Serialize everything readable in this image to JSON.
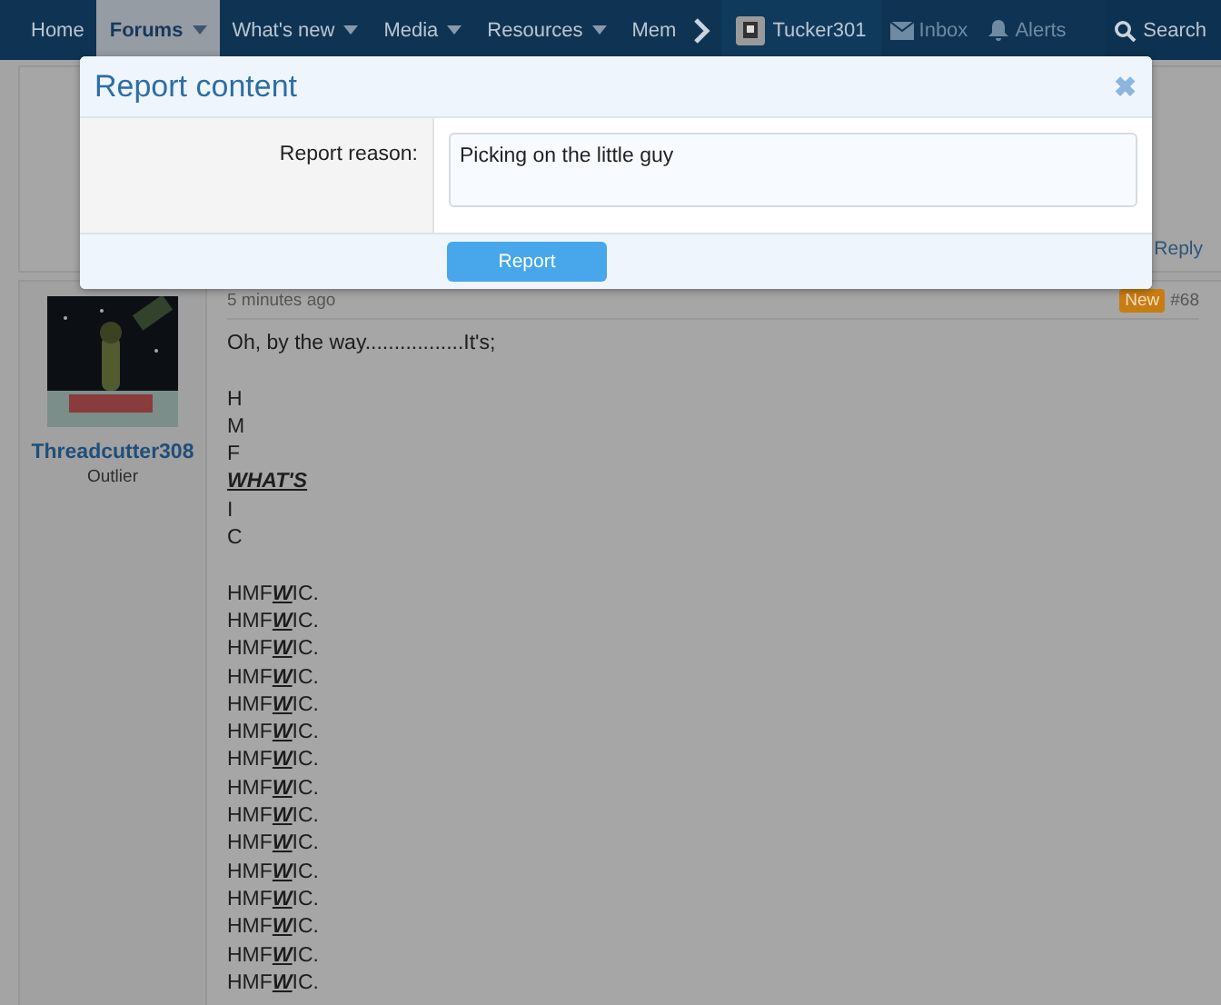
{
  "nav": {
    "items": [
      {
        "label": "Home",
        "selected": false,
        "dropdown": false
      },
      {
        "label": "Forums",
        "selected": true,
        "dropdown": true
      },
      {
        "label": "What's new",
        "selected": false,
        "dropdown": true
      },
      {
        "label": "Media",
        "selected": false,
        "dropdown": true
      },
      {
        "label": "Resources",
        "selected": false,
        "dropdown": true
      },
      {
        "label": "Mem",
        "selected": false,
        "dropdown": false
      }
    ],
    "user": "Tucker301",
    "inbox": "Inbox",
    "alerts": "Alerts",
    "search": "Search"
  },
  "previous_post": {
    "reply": "Reply"
  },
  "post": {
    "author": "Threadcutter308",
    "role": "Outlier",
    "time": "5 minutes ago",
    "badge": "New",
    "number": "#68",
    "lines": [
      {
        "kind": "text",
        "text": "Oh, by the way.................It's;"
      },
      {
        "kind": "spacer"
      },
      {
        "kind": "text",
        "text": "H"
      },
      {
        "kind": "text",
        "text": "M"
      },
      {
        "kind": "text",
        "text": "F"
      },
      {
        "kind": "emphasis",
        "text": "WHAT'S"
      },
      {
        "kind": "text",
        "text": "I"
      },
      {
        "kind": "text",
        "text": "C"
      },
      {
        "kind": "spacer"
      },
      {
        "kind": "text",
        "text": "HMF**W**IC."
      },
      {
        "kind": "text",
        "text": "HMF**W**IC."
      },
      {
        "kind": "text",
        "text": "HMF**W**IC."
      },
      {
        "kind": "text",
        "text": "HMF**W**IC."
      },
      {
        "kind": "text",
        "text": "HMF**W**IC."
      },
      {
        "kind": "text",
        "text": "HMF**W**IC."
      },
      {
        "kind": "text",
        "text": "HMF**W**IC."
      },
      {
        "kind": "text",
        "text": "HMF**W**IC."
      },
      {
        "kind": "text",
        "text": "HMF**W**IC."
      },
      {
        "kind": "text",
        "text": "HMF**W**IC."
      },
      {
        "kind": "text",
        "text": "HMF**W**IC."
      },
      {
        "kind": "text",
        "text": "HMF**W**IC."
      },
      {
        "kind": "text",
        "text": "HMF**W**IC."
      },
      {
        "kind": "text",
        "text": "HMF**W**IC."
      },
      {
        "kind": "text",
        "text": "HMF**W**IC."
      }
    ]
  },
  "dialog": {
    "title": "Report content",
    "close": "✖",
    "field_label": "Report reason:",
    "field_value": "Picking on the little guy",
    "button": "Report"
  }
}
